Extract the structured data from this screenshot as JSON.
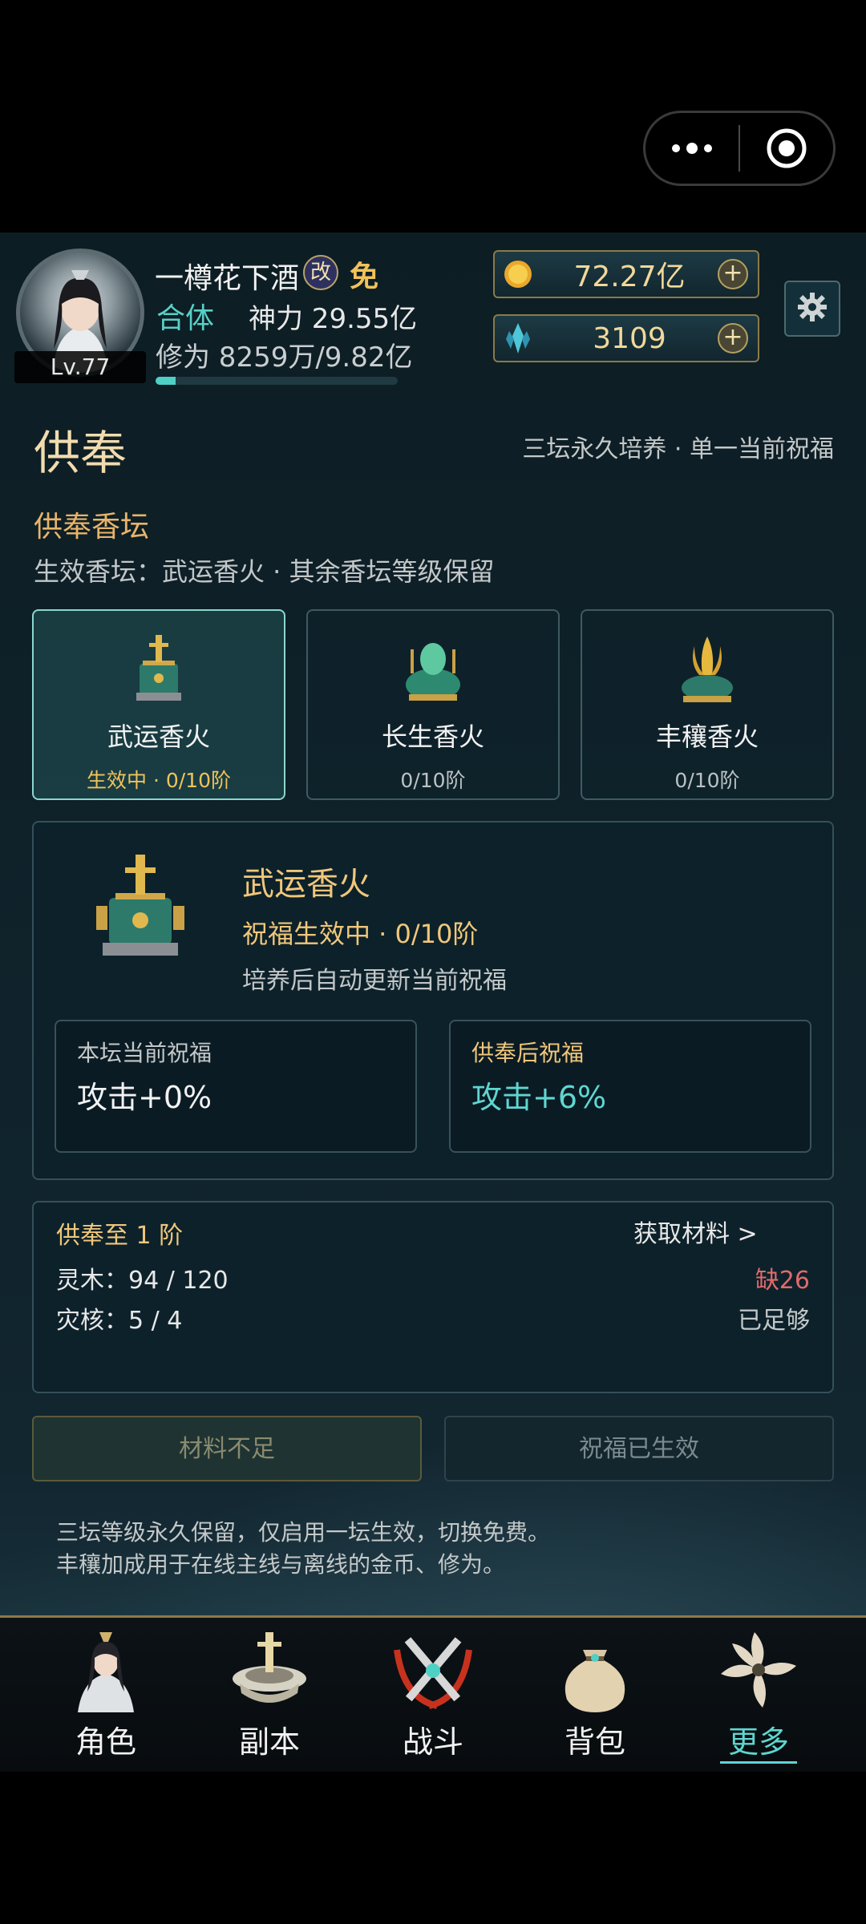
{
  "capsule": {
    "more_icon": "more-dots-icon",
    "close_icon": "target-icon"
  },
  "player": {
    "name": "一樽花下酒",
    "tag_gai": "改",
    "tag_mian": "免",
    "level": "Lv.77",
    "realm": "合体",
    "power": "神力 29.55亿",
    "cultivation": "修为 8259万/9.82亿",
    "cultivation_progress": 0.084
  },
  "resources": {
    "gold": {
      "value": "72.27亿",
      "icon": "gold-coin-icon"
    },
    "crystal": {
      "value": "3109",
      "icon": "crystal-icon"
    }
  },
  "page": {
    "title": "供奉",
    "subtitle": "三坛永久培养 · 单一当前祝福",
    "section": "供奉香坛",
    "effective": "生效香坛：武运香火 · 其余香坛等级保留"
  },
  "altars": [
    {
      "name": "武运香火",
      "status": "生效中 · 0/10阶",
      "icon": "martial-censer-icon"
    },
    {
      "name": "长生香火",
      "status": "0/10阶",
      "icon": "longevity-censer-icon"
    },
    {
      "name": "丰穰香火",
      "status": "0/10阶",
      "icon": "harvest-censer-icon"
    }
  ],
  "detail": {
    "name": "武运香火",
    "status": "祝福生效中 · 0/10阶",
    "note": "培养后自动更新当前祝福",
    "current_label": "本坛当前祝福",
    "current_value": "攻击+0%",
    "after_label": "供奉后祝福",
    "after_value": "攻击+6%"
  },
  "materials": {
    "title": "供奉至 1 阶",
    "link": "获取材料 >",
    "rows": [
      {
        "label": "灵木：",
        "count": "94 / 120",
        "status": "缺26"
      },
      {
        "label": "灾核：",
        "count": "5 / 4",
        "status": "已足够"
      }
    ]
  },
  "buttons": {
    "offer": "材料不足",
    "blessed": "祝福已生效"
  },
  "notes": [
    "三坛等级永久保留，仅启用一坛生效，切换免费。",
    "丰穰加成用于在线主线与离线的金币、修为。"
  ],
  "nav": [
    {
      "label": "角色",
      "icon": "character-icon"
    },
    {
      "label": "副本",
      "icon": "dungeon-icon"
    },
    {
      "label": "战斗",
      "icon": "battle-icon"
    },
    {
      "label": "背包",
      "icon": "bag-icon"
    },
    {
      "label": "更多",
      "icon": "more-icon"
    }
  ],
  "colors": {
    "accent": "#5fd6d0",
    "gold": "#f0c77a",
    "warn": "#e06a6a"
  }
}
